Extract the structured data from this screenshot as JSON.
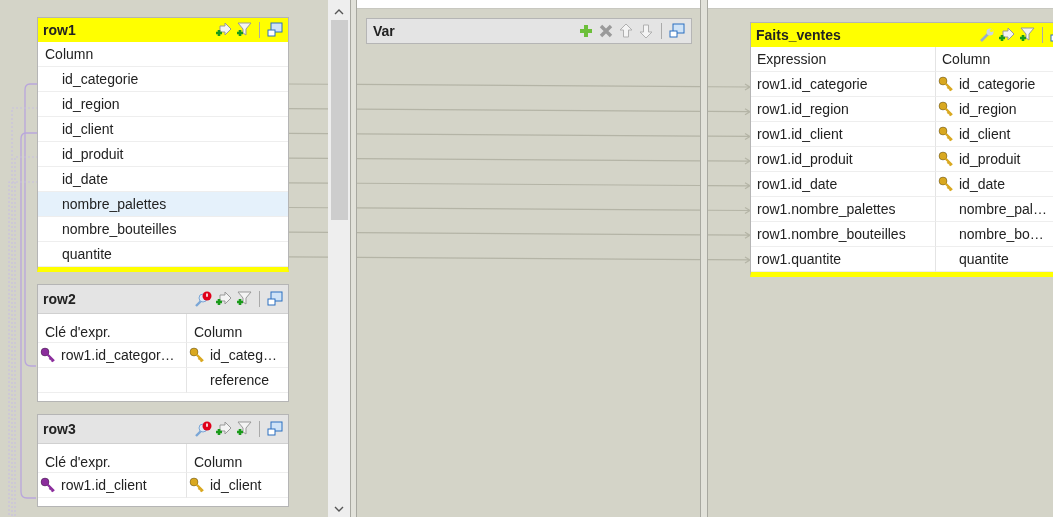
{
  "inputs": [
    {
      "title": "row1",
      "kind": "main",
      "active": true,
      "headers": [
        "Column"
      ],
      "rows": [
        {
          "column": "id_categorie",
          "selected": false
        },
        {
          "column": "id_region",
          "selected": false
        },
        {
          "column": "id_client",
          "selected": false
        },
        {
          "column": "id_produit",
          "selected": false
        },
        {
          "column": "id_date",
          "selected": false
        },
        {
          "column": "nombre_palettes",
          "selected": true
        },
        {
          "column": "nombre_bouteilles",
          "selected": false
        },
        {
          "column": "quantite",
          "selected": false
        }
      ]
    },
    {
      "title": "row2",
      "kind": "lookup",
      "active": false,
      "headers": [
        "Clé d'expr.",
        "Column"
      ],
      "rows": [
        {
          "expression": "row1.id_categor…",
          "expression_key": true,
          "column": "id_categ…",
          "column_key": true
        },
        {
          "expression_key": false,
          "column": "reference",
          "column_key": false
        }
      ]
    },
    {
      "title": "row3",
      "kind": "lookup",
      "active": false,
      "headers": [
        "Clé d'expr.",
        "Column"
      ],
      "rows": [
        {
          "expression": "row1.id_client",
          "expression_key": true,
          "column": "id_client",
          "column_key": true
        }
      ]
    }
  ],
  "variables": {
    "title": "Var"
  },
  "outputs": [
    {
      "title": "Faits_ventes",
      "kind": "output",
      "active": true,
      "headers": [
        "Expression",
        "Column"
      ],
      "rows": [
        {
          "expression": "row1.id_categorie",
          "column": "id_categorie",
          "column_key": true
        },
        {
          "expression": "row1.id_region",
          "column": "id_region",
          "column_key": true
        },
        {
          "expression": "row1.id_client",
          "column": "id_client",
          "column_key": true
        },
        {
          "expression": "row1.id_produit",
          "column": "id_produit",
          "column_key": true
        },
        {
          "expression": "row1.id_date",
          "column": "id_date",
          "column_key": true
        },
        {
          "expression": "row1.nombre_palettes",
          "column": "nombre_pal…",
          "column_key": false
        },
        {
          "expression": "row1.nombre_bouteilles",
          "column": "nombre_bo…",
          "column_key": false
        },
        {
          "expression": "row1.quantite",
          "column": "quantite",
          "column_key": false
        }
      ]
    }
  ]
}
